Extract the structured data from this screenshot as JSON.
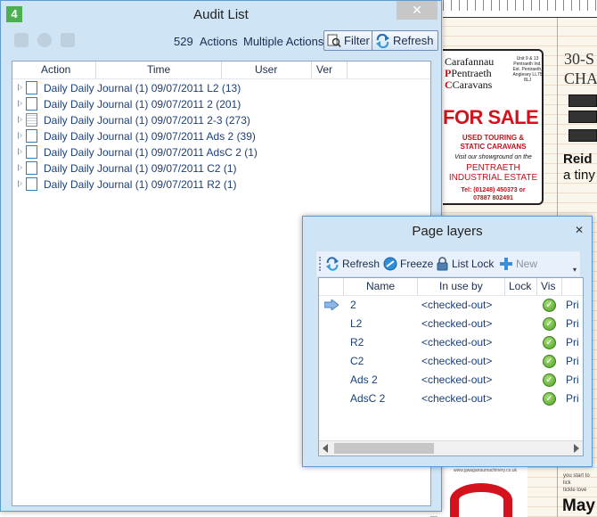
{
  "audit": {
    "title": "Audit List",
    "app_icon_glyph": "4",
    "count": "529",
    "actions_label": "Actions",
    "dropdown_value": "Multiple Actions",
    "filter_label": "Filter",
    "refresh_label": "Refresh",
    "columns": [
      "Action",
      "Time",
      "User",
      "Ver"
    ],
    "rows": [
      {
        "text": "Daily Daily Journal (1) 09/07/2011 L2 (13)",
        "icon": "document-icon"
      },
      {
        "text": "Daily Daily Journal (1) 09/07/2011 2 (201)",
        "icon": "document-icon"
      },
      {
        "text": "Daily Daily Journal (1) 09/07/2011 2-3 (273)",
        "icon": "document-lines-icon"
      },
      {
        "text": "Daily Daily Journal (1) 09/07/2011 Ads 2 (39)",
        "icon": "document-icon"
      },
      {
        "text": "Daily Daily Journal (1) 09/07/2011 AdsC 2 (1)",
        "icon": "document-icon"
      },
      {
        "text": "Daily Daily Journal (1) 09/07/2011 C2 (1)",
        "icon": "document-icon"
      },
      {
        "text": "Daily Daily Journal (1) 09/07/2011 R2 (1)",
        "icon": "document-icon"
      }
    ]
  },
  "layers": {
    "title": "Page layers",
    "toolbar": {
      "refresh": "Refresh",
      "freeze": "Freeze",
      "list_lock": "List Lock",
      "new": "New"
    },
    "columns": [
      "Name",
      "In use by",
      "Lock",
      "Vis"
    ],
    "rows": [
      {
        "name": "2",
        "in_use_by": "<checked-out>",
        "extra": "Pri",
        "current": true
      },
      {
        "name": "L2",
        "in_use_by": "<checked-out>",
        "extra": "Pri",
        "current": false
      },
      {
        "name": "R2",
        "in_use_by": "<checked-out>",
        "extra": "Pri",
        "current": false
      },
      {
        "name": "C2",
        "in_use_by": "<checked-out>",
        "extra": "Pri",
        "current": false
      },
      {
        "name": "Ads 2",
        "in_use_by": "<checked-out>",
        "extra": "Pri",
        "current": false
      },
      {
        "name": "AdsC 2",
        "in_use_by": "<checked-out>",
        "extra": "Pri",
        "current": false
      }
    ]
  },
  "background_page": {
    "ad_head": [
      "Carafannau",
      "Pentraeth",
      "Caravans"
    ],
    "ad_address": "Unit 9 & 13 Pentraeth Ind. Est. Pentraeth, Anglesey LL75 8LJ",
    "ad_sale": "FOR SALE",
    "ad_sub": [
      "USED TOURING &",
      "STATIC CARAVANS"
    ],
    "ad_showroom": "Visit our showground on the",
    "ad_estate": [
      "PENTRAETH",
      "INDUSTRIAL ESTATE"
    ],
    "ad_tel": [
      "Tel: (01248) 450373 or",
      "07887 802491"
    ],
    "header_right": [
      "30-S",
      "CHA"
    ],
    "reid": [
      "Reid",
      "a tiny"
    ],
    "url_strip": "www.gwaganaumachinery.co.uk",
    "tiny_text": [
      "you start to lick",
      "tickle love"
    ],
    "may": "May"
  },
  "colors": {
    "window_bg": "#cfe4f5",
    "accent_text": "#1c3f75",
    "vis_green": "#4d9e23",
    "ad_red": "#d4111c"
  }
}
